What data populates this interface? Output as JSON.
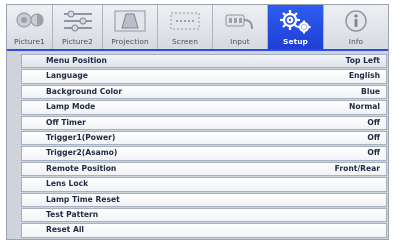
{
  "tabs": [
    {
      "label": "Picture1",
      "icon": "picture1-icon",
      "active": false
    },
    {
      "label": "Picture2",
      "icon": "picture2-icon",
      "active": false
    },
    {
      "label": "Projection",
      "icon": "projection-icon",
      "active": false
    },
    {
      "label": "Screen",
      "icon": "screen-icon",
      "active": false
    },
    {
      "label": "Input",
      "icon": "input-icon",
      "active": false
    },
    {
      "label": "Setup",
      "icon": "gear-icon",
      "active": true
    },
    {
      "label": "Info",
      "icon": "info-icon",
      "active": false
    }
  ],
  "colors": {
    "accent": "#2a50d8",
    "panel": "#cfd3db",
    "row_text": "#1e2a46"
  },
  "menu": {
    "items": [
      {
        "label": "Menu Position",
        "value": "Top Left"
      },
      {
        "label": "Language",
        "value": "English"
      },
      {
        "label": "Background Color",
        "value": "Blue"
      },
      {
        "label": "Lamp Mode",
        "value": "Normal"
      },
      {
        "label": "Off Timer",
        "value": "Off"
      },
      {
        "label": "Trigger1(Power)",
        "value": "Off"
      },
      {
        "label": "Trigger2(Asamo)",
        "value": "Off"
      },
      {
        "label": "Remote Position",
        "value": "Front/Rear"
      },
      {
        "label": "Lens Lock",
        "value": ""
      },
      {
        "label": "Lamp Time Reset",
        "value": ""
      },
      {
        "label": "Test Pattern",
        "value": ""
      },
      {
        "label": "Reset All",
        "value": ""
      }
    ]
  }
}
